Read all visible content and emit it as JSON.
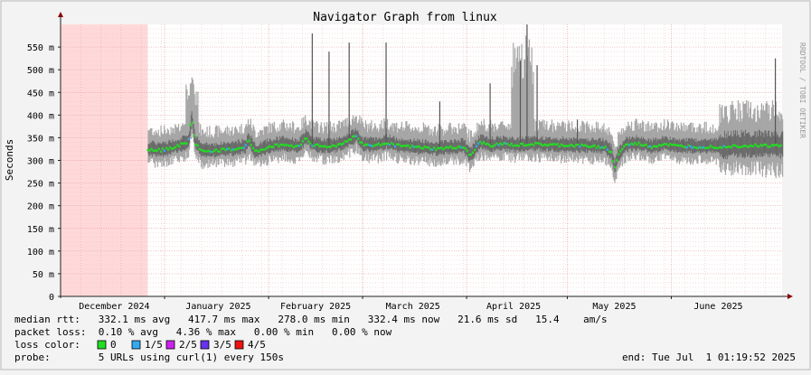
{
  "chart_data": {
    "type": "line",
    "title": "Navigator Graph from linux",
    "ylabel": "Seconds",
    "watermark": "RRDTOOL / TOBI OETIKER",
    "ylim": [
      0,
      600
    ],
    "y_ticks": [
      {
        "value": 0,
        "label": "0"
      },
      {
        "value": 50,
        "label": "50 m"
      },
      {
        "value": 100,
        "label": "100 m"
      },
      {
        "value": 150,
        "label": "150 m"
      },
      {
        "value": 200,
        "label": "200 m"
      },
      {
        "value": 250,
        "label": "250 m"
      },
      {
        "value": 300,
        "label": "300 m"
      },
      {
        "value": 350,
        "label": "350 m"
      },
      {
        "value": 400,
        "label": "400 m"
      },
      {
        "value": 450,
        "label": "450 m"
      },
      {
        "value": 500,
        "label": "500 m"
      },
      {
        "value": 550,
        "label": "550 m"
      }
    ],
    "x_range_days": [
      0,
      215
    ],
    "x_month_labels": [
      {
        "label": "December 2024",
        "day": 16
      },
      {
        "label": "January 2025",
        "day": 47
      },
      {
        "label": "February 2025",
        "day": 76
      },
      {
        "label": "March 2025",
        "day": 105
      },
      {
        "label": "April 2025",
        "day": 135
      },
      {
        "label": "May 2025",
        "day": 165
      },
      {
        "label": "June 2025",
        "day": 196
      }
    ],
    "month_boundaries": [
      31,
      62,
      90,
      121,
      151,
      182
    ],
    "no_data_range_days": [
      0,
      26
    ],
    "data_start_day": 26,
    "grid": true,
    "series": [
      {
        "name": "median rtt",
        "points": [
          [
            26,
            325
          ],
          [
            30,
            322
          ],
          [
            34,
            330
          ],
          [
            38,
            340
          ],
          [
            39,
            395
          ],
          [
            40,
            340
          ],
          [
            42,
            320
          ],
          [
            47,
            322
          ],
          [
            52,
            325
          ],
          [
            55,
            330
          ],
          [
            56,
            345
          ],
          [
            58,
            318
          ],
          [
            62,
            330
          ],
          [
            66,
            335
          ],
          [
            71,
            330
          ],
          [
            73,
            350
          ],
          [
            75,
            335
          ],
          [
            78,
            330
          ],
          [
            82,
            332
          ],
          [
            86,
            345
          ],
          [
            88,
            355
          ],
          [
            90,
            335
          ],
          [
            94,
            332
          ],
          [
            97,
            340
          ],
          [
            100,
            333
          ],
          [
            104,
            330
          ],
          [
            108,
            328
          ],
          [
            112,
            325
          ],
          [
            116,
            328
          ],
          [
            120,
            330
          ],
          [
            122,
            310
          ],
          [
            125,
            340
          ],
          [
            128,
            333
          ],
          [
            132,
            336
          ],
          [
            136,
            333
          ],
          [
            140,
            336
          ],
          [
            146,
            334
          ],
          [
            152,
            333
          ],
          [
            158,
            331
          ],
          [
            162,
            330
          ],
          [
            164,
            318
          ],
          [
            165,
            282
          ],
          [
            166,
            310
          ],
          [
            168,
            333
          ],
          [
            172,
            337
          ],
          [
            176,
            330
          ],
          [
            180,
            336
          ],
          [
            184,
            331
          ],
          [
            190,
            330
          ],
          [
            196,
            330
          ],
          [
            202,
            332
          ],
          [
            208,
            333
          ],
          [
            215,
            332
          ]
        ]
      }
    ],
    "loss_color_key": [
      {
        "label": "0",
        "color": "#22dd22"
      },
      {
        "label": "1/5",
        "color": "#33aaee"
      },
      {
        "label": "2/5",
        "color": "#cc22ee"
      },
      {
        "label": "3/5",
        "color": "#6633ee"
      },
      {
        "label": "4/5",
        "color": "#ee1111"
      }
    ],
    "band_colors": {
      "outer": "#a6a6a6",
      "inner": "#666666",
      "no_data": "#ffd9d9",
      "no_data_grid": "#ff9f9f"
    }
  },
  "stats": {
    "median_rtt": "median rtt:   332.1 ms avg   417.7 ms max   278.0 ms min   332.4 ms now   21.6 ms sd   15.4    am/s",
    "packet_loss": "packet loss:  0.10 % avg   4.36 % max   0.00 % min   0.00 % now",
    "loss_color_label": "loss color:",
    "probe": "probe:        5 URLs using curl(1) every 150s",
    "end": "end: Tue Jul  1 01:19:52 2025"
  }
}
